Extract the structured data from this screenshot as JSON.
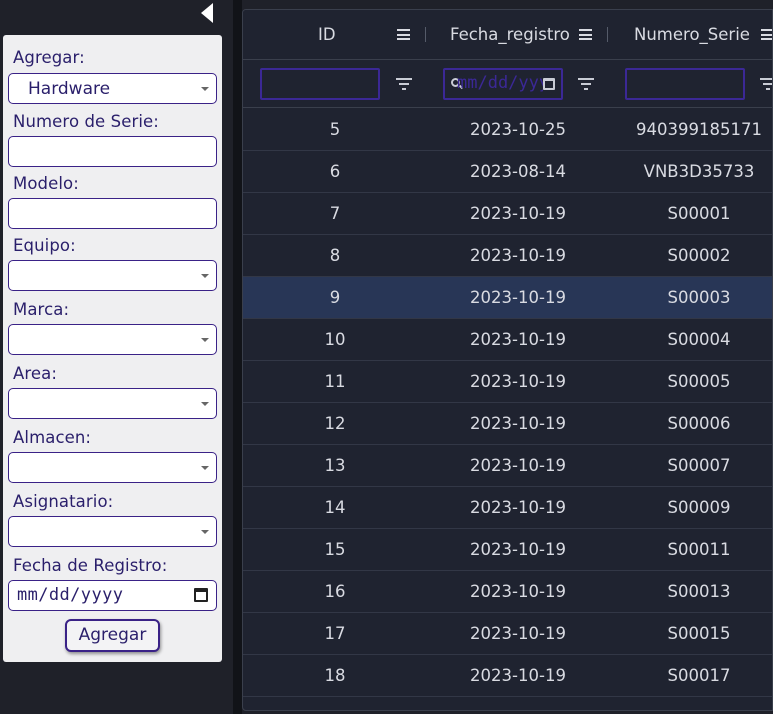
{
  "form": {
    "agregar_label": "Agregar:",
    "agregar_value": "Hardware",
    "numero_serie_label": "Numero de Serie:",
    "numero_serie_value": "",
    "modelo_label": "Modelo:",
    "modelo_value": "",
    "equipo_label": "Equipo:",
    "marca_label": "Marca:",
    "area_label": "Area:",
    "almacen_label": "Almacen:",
    "asignatario_label": "Asignatario:",
    "fecha_label": "Fecha de Registro:",
    "fecha_placeholder": "mm/dd/yyyy",
    "submit_label": "Agregar"
  },
  "grid": {
    "columns": [
      "ID",
      "Fecha_registro",
      "Numero_Serie"
    ],
    "date_filter_placeholder": "mm/dd/yyyy",
    "selected_row_id": "9",
    "rows": [
      {
        "id": "5",
        "fecha": "2023-10-25",
        "serie": "940399185171"
      },
      {
        "id": "6",
        "fecha": "2023-08-14",
        "serie": "VNB3D35733"
      },
      {
        "id": "7",
        "fecha": "2023-10-19",
        "serie": "S00001"
      },
      {
        "id": "8",
        "fecha": "2023-10-19",
        "serie": "S00002"
      },
      {
        "id": "9",
        "fecha": "2023-10-19",
        "serie": "S00003"
      },
      {
        "id": "10",
        "fecha": "2023-10-19",
        "serie": "S00004"
      },
      {
        "id": "11",
        "fecha": "2023-10-19",
        "serie": "S00005"
      },
      {
        "id": "12",
        "fecha": "2023-10-19",
        "serie": "S00006"
      },
      {
        "id": "13",
        "fecha": "2023-10-19",
        "serie": "S00007"
      },
      {
        "id": "14",
        "fecha": "2023-10-19",
        "serie": "S00009"
      },
      {
        "id": "15",
        "fecha": "2023-10-19",
        "serie": "S00011"
      },
      {
        "id": "16",
        "fecha": "2023-10-19",
        "serie": "S00013"
      },
      {
        "id": "17",
        "fecha": "2023-10-19",
        "serie": "S00015"
      },
      {
        "id": "18",
        "fecha": "2023-10-19",
        "serie": "S00017"
      }
    ]
  },
  "colors": {
    "panel_bg": "#efeff1",
    "accent": "#3a2287",
    "grid_bg": "#1f2330",
    "selected_row": "#283656"
  }
}
